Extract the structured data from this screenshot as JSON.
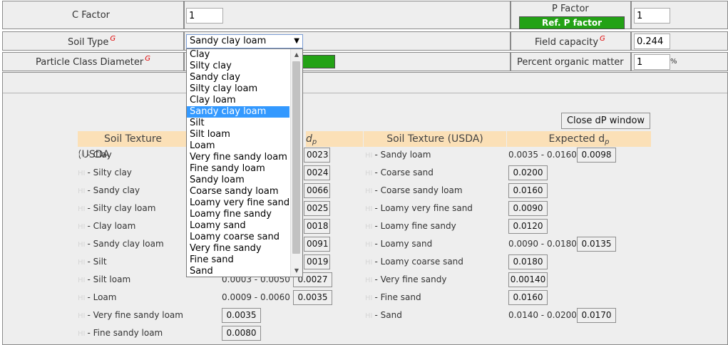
{
  "form": {
    "c_factor": {
      "label": "C Factor",
      "value": "1"
    },
    "p_factor": {
      "label": "P Factor",
      "button": "Ref. P factor",
      "value": "1"
    },
    "soil_type": {
      "label": "Soil Type",
      "marker": "G",
      "selected": "Sandy clay loam"
    },
    "field_capacity": {
      "label": "Field capacity",
      "marker": "G",
      "value": "0.244"
    },
    "particle_class": {
      "label": "Particle Class Diameter",
      "marker": "G"
    },
    "organic_matter": {
      "label": "Percent organic matter",
      "value": "1",
      "unit": "%"
    }
  },
  "dropdown": {
    "options": [
      "Clay",
      "Silty clay",
      "Sandy clay",
      "Silty clay loam",
      "Clay loam",
      "Sandy clay loam",
      "Silt",
      "Silt loam",
      "Loam",
      "Very fine sandy loam",
      "Fine sandy loam",
      "Sandy loam",
      "Coarse sandy loam",
      "Loamy very fine sand",
      "Loamy fine sandy",
      "Loamy sand",
      "Loamy coarse sand",
      "Very fine sandy",
      "Fine sand",
      "Sand"
    ],
    "selected_index": 5
  },
  "dp_window": {
    "close_button": "Close dP window",
    "headers": {
      "soil_texture": "Soil Texture (USDA)",
      "expected": "Expected d",
      "expected_sub": "p",
      "left_texture_visible": "Soil Texture (USDA",
      "left_expected_visible": "d",
      "left_expected_sub": "p"
    },
    "hi_marker": "HI",
    "left_rows": [
      {
        "label": "- Clay",
        "range": "",
        "value": "0.0023"
      },
      {
        "label": "- Silty clay",
        "range": "",
        "value": "0.0024"
      },
      {
        "label": "- Sandy clay",
        "range": "",
        "value": "0.0066"
      },
      {
        "label": "- Silty clay loam",
        "range": "",
        "value": "0.0025"
      },
      {
        "label": "- Clay loam",
        "range": "",
        "value": "0.0018"
      },
      {
        "label": "- Sandy clay loam",
        "range": "",
        "value": "0.0091"
      },
      {
        "label": "- Silt",
        "range": "",
        "value": "0.0019"
      },
      {
        "label": "- Silt loam",
        "range": "0.0003 - 0.0050",
        "value": "0.0027"
      },
      {
        "label": "- Loam",
        "range": "0.0009 - 0.0060",
        "value": "0.0035"
      },
      {
        "label": "- Very fine sandy loam",
        "range": "",
        "value": "0.0035"
      },
      {
        "label": "- Fine sandy loam",
        "range": "",
        "value": "0.0080"
      }
    ],
    "left_visible_values": [
      "0023",
      "0024",
      "0066",
      "0025",
      "0018",
      "0091",
      "0019"
    ],
    "right_rows": [
      {
        "label": "- Sandy loam",
        "range": "0.0035 - 0.0160",
        "value": "0.0098"
      },
      {
        "label": "- Coarse sand",
        "range": "",
        "value": "0.0200"
      },
      {
        "label": "- Coarse sandy loam",
        "range": "",
        "value": "0.0160"
      },
      {
        "label": "- Loamy very fine sand",
        "range": "",
        "value": "0.0090"
      },
      {
        "label": "- Loamy fine sandy",
        "range": "",
        "value": "0.0120"
      },
      {
        "label": "- Loamy sand",
        "range": "0.0090 - 0.0180",
        "value": "0.0135"
      },
      {
        "label": "- Loamy coarse sand",
        "range": "",
        "value": "0.0180"
      },
      {
        "label": "- Very fine sandy",
        "range": "",
        "value": "0.00140"
      },
      {
        "label": "- Fine sand",
        "range": "",
        "value": "0.0160"
      },
      {
        "label": "- Sand",
        "range": "0.0140 - 0.0200",
        "value": "0.0170"
      }
    ]
  },
  "colors": {
    "green": "#23a215",
    "header_bg": "#fbe0b7",
    "selection": "#3399ff",
    "marker": "#e00000"
  }
}
